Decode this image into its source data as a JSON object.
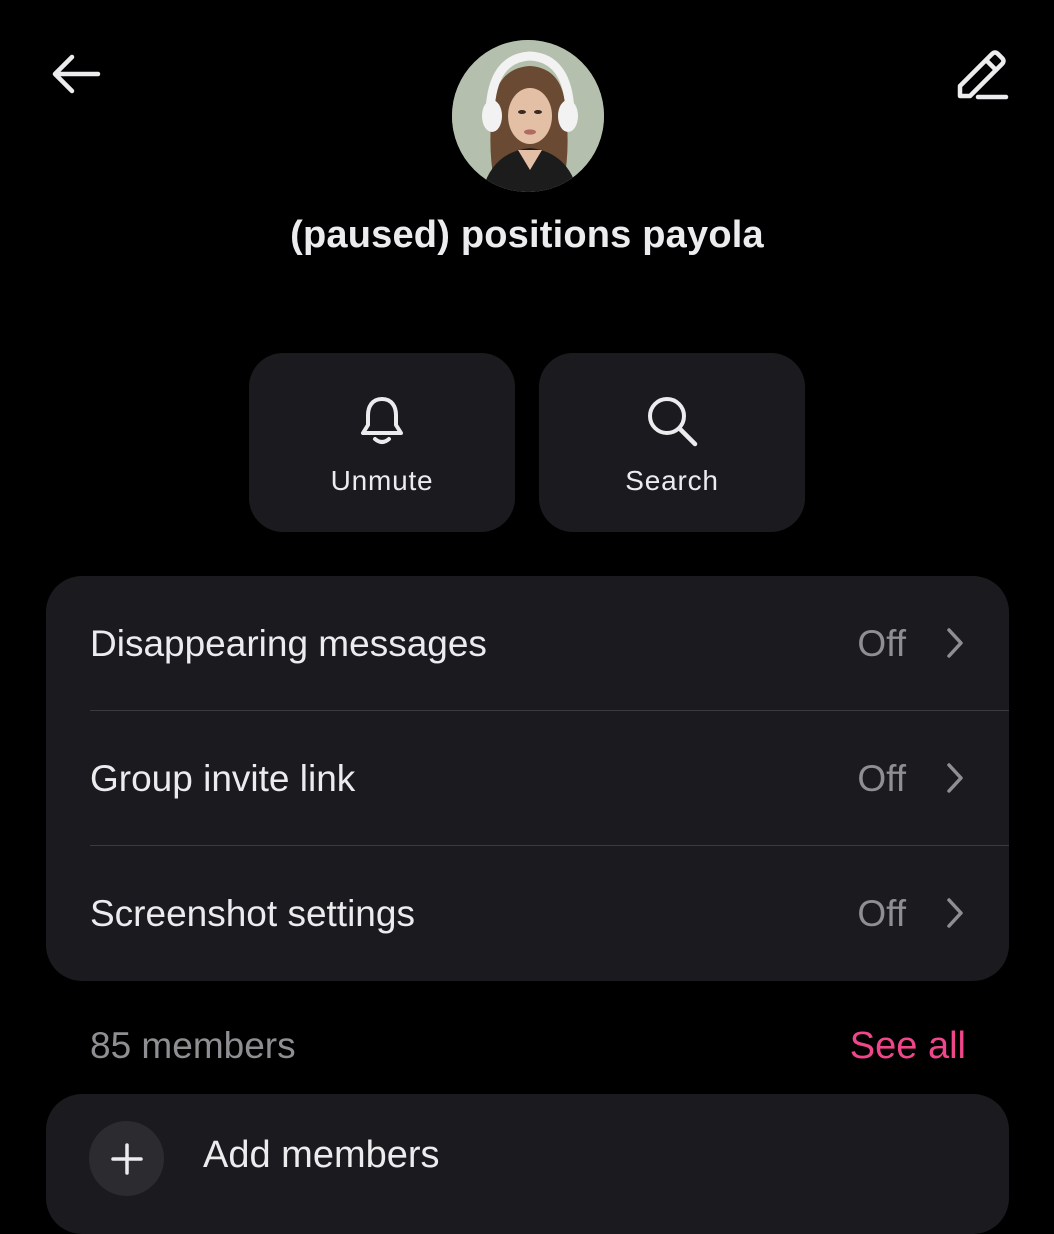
{
  "header": {
    "back_icon": "arrow-left-icon",
    "edit_icon": "pencil-edit-icon"
  },
  "group": {
    "name": "(paused) positions payola",
    "avatar": "group-avatar-photo"
  },
  "actions": [
    {
      "label": "Unmute",
      "icon": "bell-icon"
    },
    {
      "label": "Search",
      "icon": "search-icon"
    }
  ],
  "settings": [
    {
      "label": "Disappearing messages",
      "value": "Off"
    },
    {
      "label": "Group invite link",
      "value": "Off"
    },
    {
      "label": "Screenshot settings",
      "value": "Off"
    }
  ],
  "members": {
    "count_label": "85 members",
    "see_all_label": "See all",
    "add_label": "Add members",
    "add_icon": "plus-icon"
  },
  "colors": {
    "background": "#000000",
    "card": "#1B1B1F",
    "accent": "#F0468A",
    "primary_text": "#ECECEE",
    "secondary_text": "#8E8E93"
  }
}
